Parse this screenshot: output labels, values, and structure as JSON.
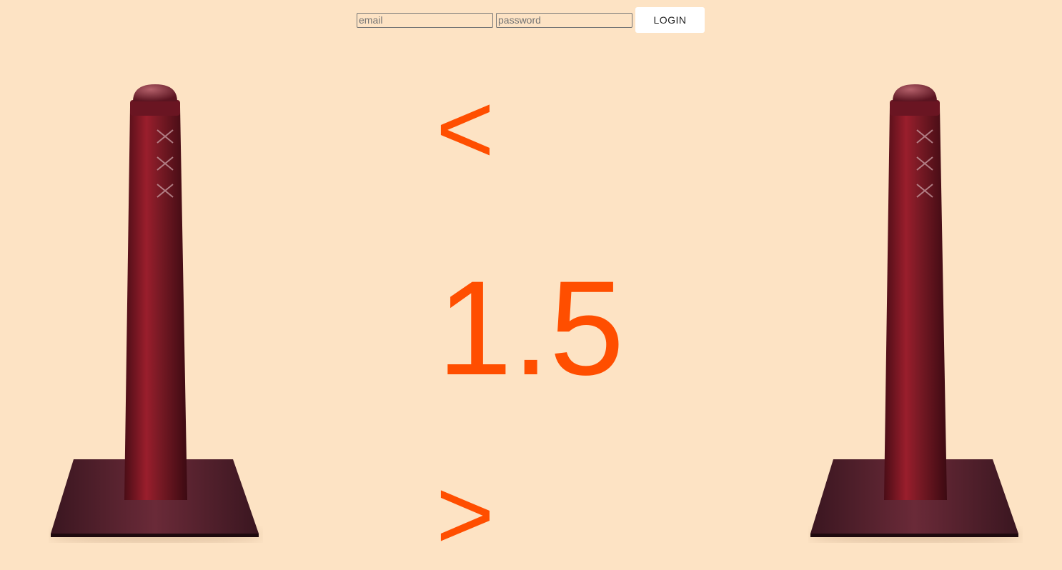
{
  "login": {
    "email_placeholder": "email",
    "password_placeholder": "password",
    "button_label": "LOGIN"
  },
  "navigation": {
    "prev_label": "<",
    "next_label": ">"
  },
  "display": {
    "value": "1.5"
  },
  "colors": {
    "background": "#fde3c4",
    "accent": "#ff4e00",
    "bollard": "#7a1a25"
  },
  "images": {
    "left": "bollard-icon",
    "right": "bollard-icon"
  }
}
